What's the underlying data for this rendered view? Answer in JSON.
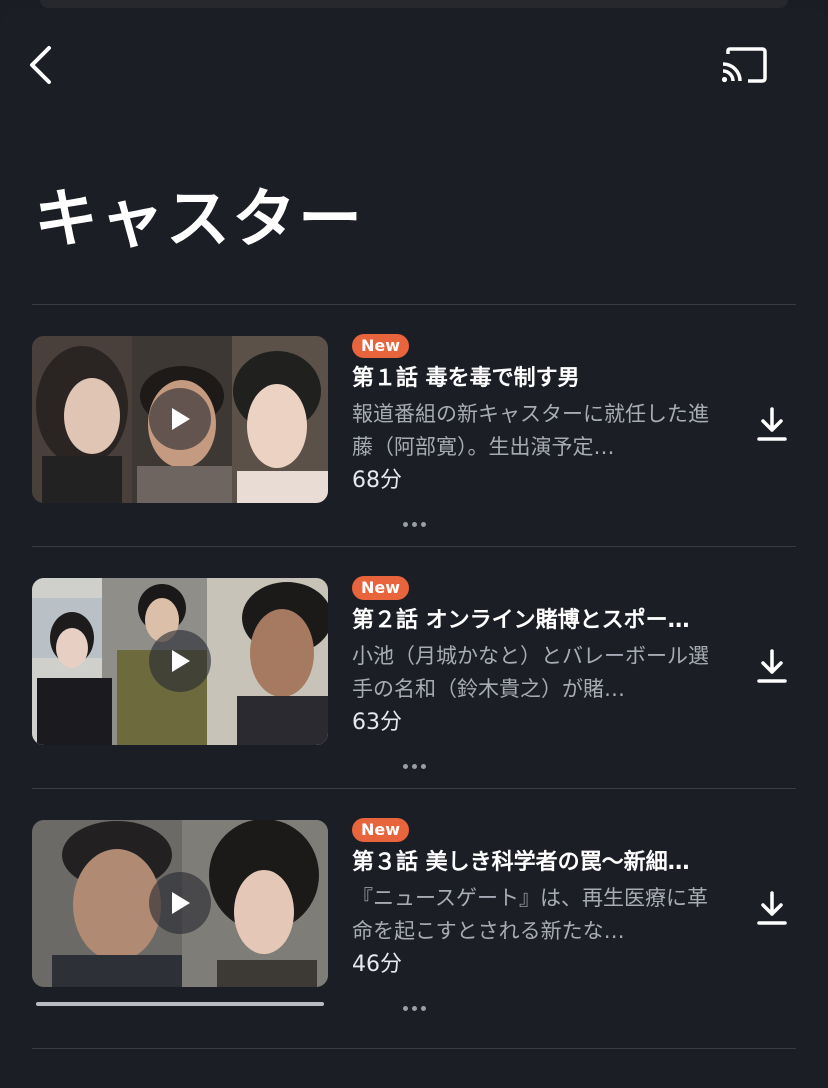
{
  "header": {
    "back_icon": "chevron-left-icon",
    "cast_icon": "cast-icon",
    "title": "キャスター"
  },
  "colors": {
    "background": "#1c1e26",
    "badge": "#e8643c",
    "divider": "#3a3c44",
    "secondary_text": "#a7abb4"
  },
  "episodes": [
    {
      "badge": "New",
      "title": "第１話 毒を毒で制す男",
      "description": "報道番組の新キャスターに就任した進藤（阿部寛）。生出演予定…",
      "duration": "68分",
      "progress": 0
    },
    {
      "badge": "New",
      "title": "第２話 オンライン賭博とスポー…",
      "description": "小池（月城かなと）とバレーボール選手の名和（鈴木貴之）が賭…",
      "duration": "63分",
      "progress": 0
    },
    {
      "badge": "New",
      "title": "第３話 美しき科学者の罠〜新細…",
      "description": "『ニュースゲート』は、再生医療に革命を起こすとされる新たな…",
      "duration": "46分",
      "progress": 1.0
    }
  ]
}
